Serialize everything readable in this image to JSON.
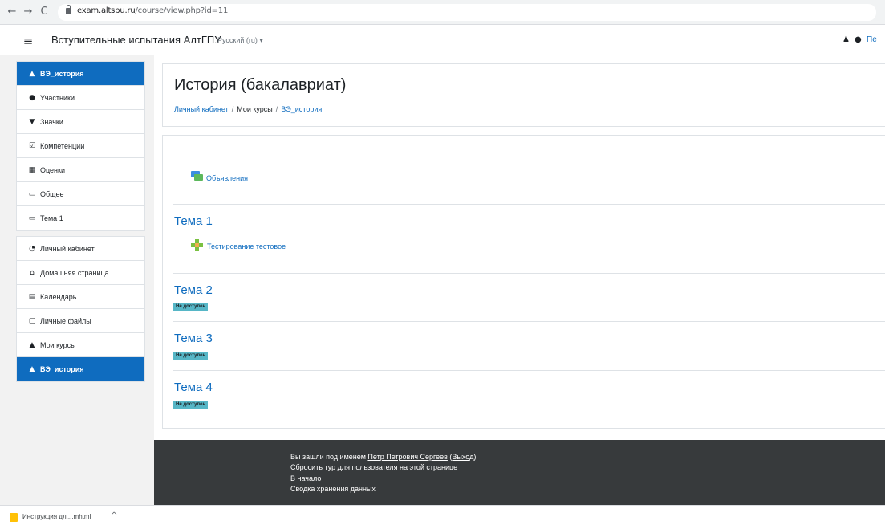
{
  "browser": {
    "back_icon": "←",
    "forward_icon": "→",
    "reload_icon": "C",
    "url_domain": "exam.altspu.ru",
    "url_path": "/course/view.php?id=11"
  },
  "navbar": {
    "menu_icon": "≡",
    "site_name": "Вступительные испытания АлтГПУ",
    "language": "Русский (ru) ▾",
    "bell_icon": "🔔",
    "chat_icon": "💬",
    "user_truncated": "Пе"
  },
  "drawer": {
    "course_items": [
      {
        "icon": "🎓",
        "label": "ВЭ_история",
        "active": true
      },
      {
        "icon": "👥",
        "label": "Участники"
      },
      {
        "icon": "🛡",
        "label": "Значки"
      },
      {
        "icon": "☑",
        "label": "Компетенции"
      },
      {
        "icon": "▦",
        "label": "Оценки"
      },
      {
        "icon": "▭",
        "label": "Общее"
      },
      {
        "icon": "▭",
        "label": "Тема 1"
      }
    ],
    "site_items": [
      {
        "icon": "◔",
        "label": "Личный кабинет"
      },
      {
        "icon": "⌂",
        "label": "Домашняя страница"
      },
      {
        "icon": "▤",
        "label": "Календарь"
      },
      {
        "icon": "▢",
        "label": "Личные файлы"
      },
      {
        "icon": "🎓",
        "label": "Мои курсы"
      }
    ],
    "current_course": {
      "icon": "🎓",
      "label": "ВЭ_история"
    }
  },
  "header": {
    "title": "История (бакалавриат)",
    "breadcrumb": [
      "Личный кабинет",
      "Мои курсы",
      "ВЭ_история"
    ],
    "breadcrumb_sep": "/"
  },
  "content": {
    "announcements": "Объявления",
    "sections": [
      {
        "title": "Тема 1",
        "activity": "Тестирование тестовое"
      },
      {
        "title": "Тема 2",
        "badge": "Не доступен"
      },
      {
        "title": "Тема 3",
        "badge": "Не доступен"
      },
      {
        "title": "Тема 4",
        "badge": "Не доступен"
      }
    ]
  },
  "footer": {
    "logged_in_prefix": "Вы зашли под именем ",
    "user_name": "Петр Петрович Сергеев",
    "logout_open": " (",
    "logout": "Выход",
    "logout_close": ")",
    "reset_tour": "Сбросить тур для пользователя на этой странице",
    "home": "В начало",
    "data_retention": "Сводка хранения данных"
  },
  "downloads": {
    "file_name": "Инструкция дл....mhtml",
    "chevron": "^"
  }
}
